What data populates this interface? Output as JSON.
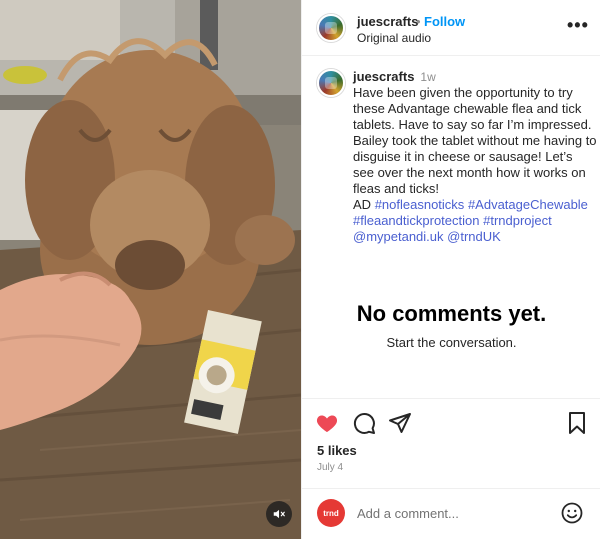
{
  "media": {
    "description_icon": "mute-icon"
  },
  "header": {
    "username": "juescrafts",
    "separator": "•",
    "follow_label": "Follow",
    "audio": "Original audio",
    "more_icon": "more-options-icon",
    "more_label": "•••"
  },
  "caption": {
    "username": "juescrafts",
    "time": "1w",
    "text": "Have been given the opportunity to try these Advantage chewable flea and tick tablets. Have to say so far I’m impressed. Bailey took the tablet without me having to disguise it in cheese or sausage! Let’s see over the next month how it works on fleas and ticks!",
    "ad_label": "AD",
    "tags": [
      "#nofleasnoticks",
      "#AdvatageChewable",
      "#fleaandtickprotection",
      "#trndproject",
      "@mypetandi.uk",
      "@trndUK"
    ]
  },
  "comments": {
    "empty_title": "No comments yet.",
    "empty_subtitle": "Start the conversation."
  },
  "actions": {
    "likes": "5 likes",
    "date": "July 4",
    "liked": true,
    "like_color": "#ed4956"
  },
  "comment_bar": {
    "avatar_text": "trnd",
    "placeholder": "Add a comment..."
  }
}
